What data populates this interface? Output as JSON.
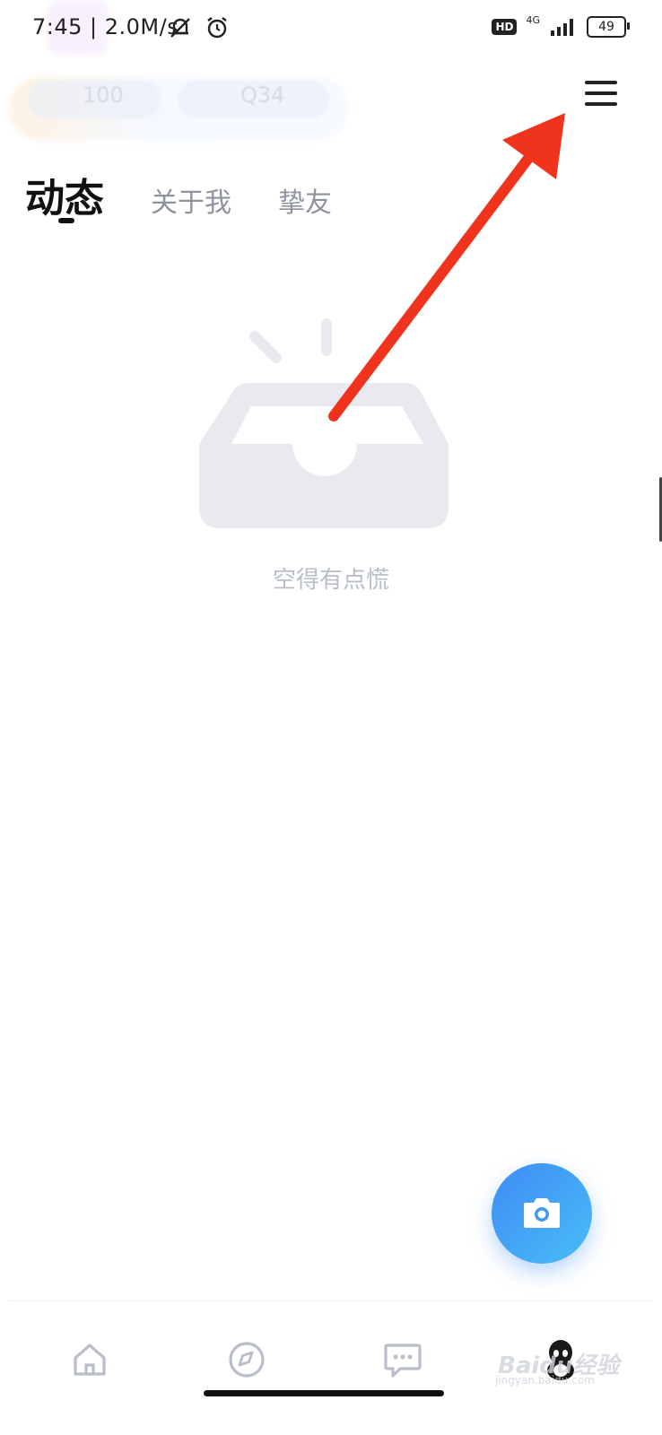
{
  "status_bar": {
    "time": "7:45",
    "speed": "| 2.0M/s",
    "hd": "HD",
    "network": "4G",
    "battery": "49"
  },
  "header_ghost": {
    "count_a": "100",
    "count_b": "Q34"
  },
  "tabs": [
    {
      "label": "动态",
      "active": true
    },
    {
      "label": "关于我",
      "active": false
    },
    {
      "label": "挚友",
      "active": false
    }
  ],
  "empty_state": {
    "text": "空得有点慌"
  },
  "bottom_nav": [
    "home-icon",
    "compass-icon",
    "message-icon",
    "avatar"
  ],
  "watermark": {
    "main": "Baidu经验",
    "sub": "jingyan.baidu.com"
  },
  "colors": {
    "fab_start": "#3f8cf5",
    "fab_end": "#48bdf6",
    "arrow": "#f0331c",
    "placeholder": "#e8eaf0"
  }
}
